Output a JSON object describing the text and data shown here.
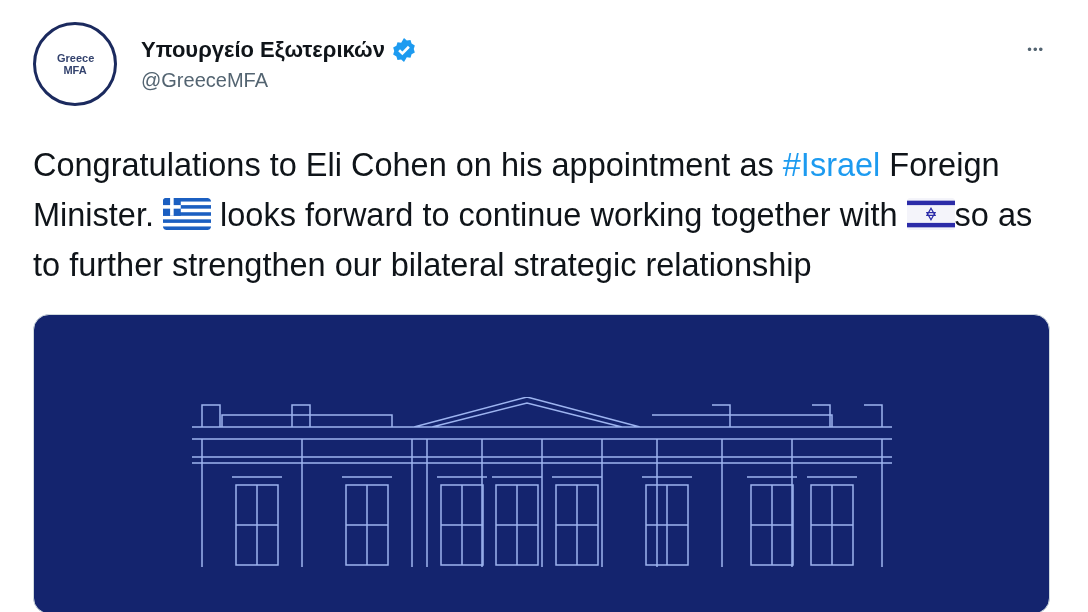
{
  "author": {
    "avatar_text": "Greece MFA",
    "name": "Υπουργείο Εξωτερικών",
    "verified": true,
    "handle": "@GreeceMFA"
  },
  "more": "•••",
  "tweet": [
    {
      "kind": "text",
      "text": "Congratulations to Eli Cohen on his appointment as "
    },
    {
      "kind": "hashtag",
      "text": "#Israel"
    },
    {
      "kind": "text",
      "text": " Foreign Minister. "
    },
    {
      "kind": "flag_gr"
    },
    {
      "kind": "text",
      "text": " looks forward to continue working together with "
    },
    {
      "kind": "flag_il"
    },
    {
      "kind": "text",
      "text": "so as to further strengthen our bilateral strategic relationship"
    }
  ]
}
